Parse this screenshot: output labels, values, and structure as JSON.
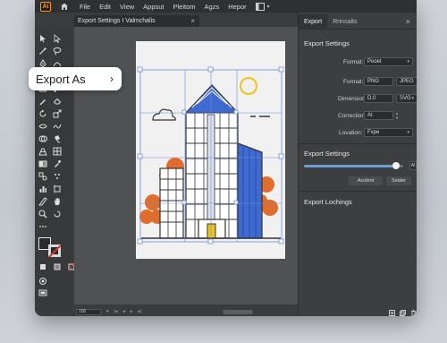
{
  "app": {
    "logo_text": "Ai"
  },
  "menubar": {
    "items": [
      "File",
      "Edit",
      "View",
      "Appsut",
      "Pleitom",
      "Agzs",
      "Hepor"
    ]
  },
  "document_tab": {
    "label": "Export Settings I Valmchalis",
    "close": "×"
  },
  "callout": {
    "label": "Export As",
    "chevron": "›"
  },
  "panel": {
    "tabs": [
      "Export",
      "Rrinsalts"
    ],
    "close": "×",
    "section1_title": "Export Settings",
    "format_row1": {
      "label": "Format:",
      "value": "Pooet"
    },
    "format_row2": {
      "label": "Format:",
      "value1": "PNG",
      "value2": "JPEG"
    },
    "dimension_row": {
      "label": "Dimension:",
      "value1": "D.0",
      "value2": "SVG"
    },
    "corrections_row": {
      "label": "Corrections:",
      "value": "At"
    },
    "location_row": {
      "label": "Lovation:",
      "value": "Fxpe"
    },
    "section2_title": "Export Settings",
    "slider": {
      "level": 0.86,
      "value_label": "Al"
    },
    "buttons": [
      "Acolent",
      "Seider"
    ],
    "section3_title": "Export Lochings"
  },
  "statusbar": {
    "zoom": "100"
  },
  "colors": {
    "accent": "#6f9bd8",
    "callout_bg": "#ffffff",
    "selection": "#6b8bd6"
  }
}
